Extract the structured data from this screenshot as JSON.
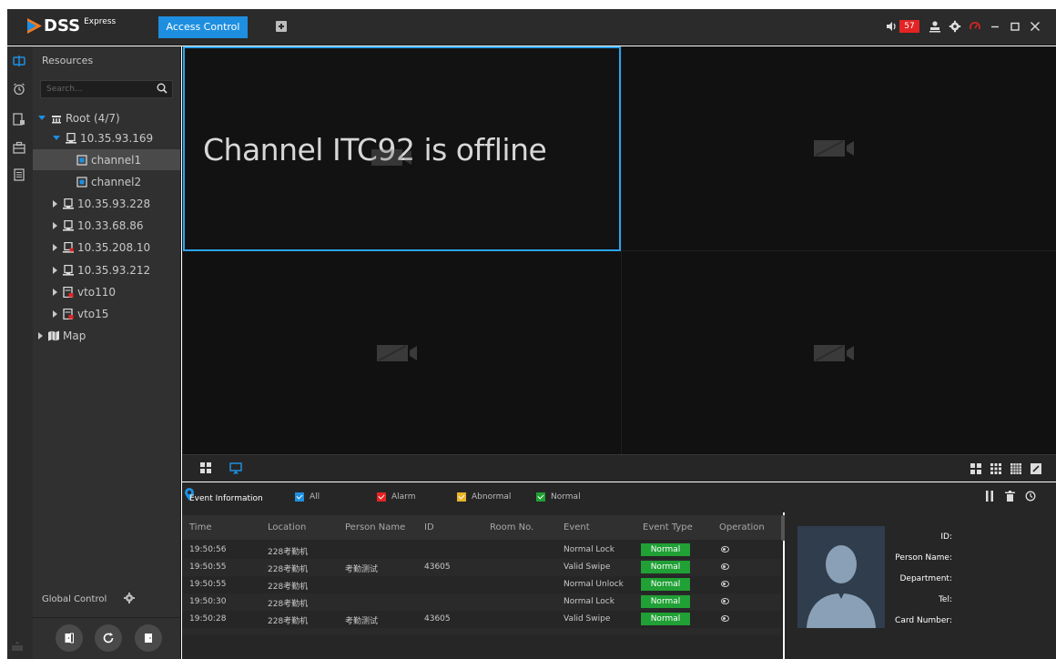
{
  "app": {
    "logo_text": "DSS",
    "logo_sub": "Express",
    "active_tab": "Access Control",
    "alarm_count": "57"
  },
  "colors": {
    "accent": "#1e8fe0",
    "selected_border": "#2ba4f0",
    "alarm_red": "#e32424",
    "normal_green": "#20a035",
    "abnormal_yellow": "#e8b527"
  },
  "resources": {
    "title": "Resources",
    "search_placeholder": "Search...",
    "tree": [
      {
        "label": "Root (4/7)",
        "indent": 0,
        "expanded": true,
        "icon": "root-icon",
        "selected": false
      },
      {
        "label": "10.35.93.169",
        "indent": 1,
        "expanded": true,
        "icon": "device-icon",
        "selected": false
      },
      {
        "label": "channel1",
        "indent": 2,
        "expanded": null,
        "icon": "channel-icon",
        "selected": true
      },
      {
        "label": "channel2",
        "indent": 2,
        "expanded": null,
        "icon": "channel-icon",
        "selected": false
      },
      {
        "label": "10.35.93.228",
        "indent": 1,
        "expanded": false,
        "icon": "device-icon",
        "selected": false
      },
      {
        "label": "10.33.68.86",
        "indent": 1,
        "expanded": false,
        "icon": "device-icon",
        "selected": false
      },
      {
        "label": "10.35.208.10",
        "indent": 1,
        "expanded": false,
        "icon": "door-device-icon",
        "selected": false
      },
      {
        "label": "10.35.93.212",
        "indent": 1,
        "expanded": false,
        "icon": "device-icon",
        "selected": false
      },
      {
        "label": "vto110",
        "indent": 1,
        "expanded": false,
        "icon": "vto-icon",
        "selected": false
      },
      {
        "label": "vto15",
        "indent": 1,
        "expanded": false,
        "icon": "vto-icon",
        "selected": false
      },
      {
        "label": "Map",
        "indent": 0,
        "expanded": false,
        "icon": "map-icon",
        "selected": false
      }
    ],
    "global_control_label": "Global Control"
  },
  "video": {
    "offline_message": "Channel ITC92 is offline"
  },
  "events": {
    "title": "Event Information",
    "filters": [
      {
        "label": "All",
        "color": "#1e8fe0"
      },
      {
        "label": "Alarm",
        "color": "#e32424"
      },
      {
        "label": "Abnormal",
        "color": "#e8b527"
      },
      {
        "label": "Normal",
        "color": "#20a035"
      }
    ],
    "columns": [
      "Time",
      "Location",
      "Person Name",
      "ID",
      "Room No.",
      "Event",
      "Event Type",
      "Operation"
    ],
    "rows": [
      {
        "time": "19:50:56",
        "location": "228考勤机",
        "person": "",
        "id": "",
        "room": "",
        "event": "Normal Lock",
        "type": "Normal"
      },
      {
        "time": "19:50:55",
        "location": "228考勤机",
        "person": "考勤测试",
        "id": "43605",
        "room": "",
        "event": "Valid Swipe",
        "type": "Normal"
      },
      {
        "time": "19:50:55",
        "location": "228考勤机",
        "person": "",
        "id": "",
        "room": "",
        "event": "Normal Unlock",
        "type": "Normal"
      },
      {
        "time": "19:50:30",
        "location": "228考勤机",
        "person": "",
        "id": "",
        "room": "",
        "event": "Normal Lock",
        "type": "Normal"
      },
      {
        "time": "19:50:28",
        "location": "228考勤机",
        "person": "考勤测试",
        "id": "43605",
        "room": "",
        "event": "Valid Swipe",
        "type": "Normal"
      }
    ]
  },
  "details": {
    "labels": [
      "ID:",
      "Person Name:",
      "Department:",
      "Tel:",
      "Card Number:"
    ]
  }
}
